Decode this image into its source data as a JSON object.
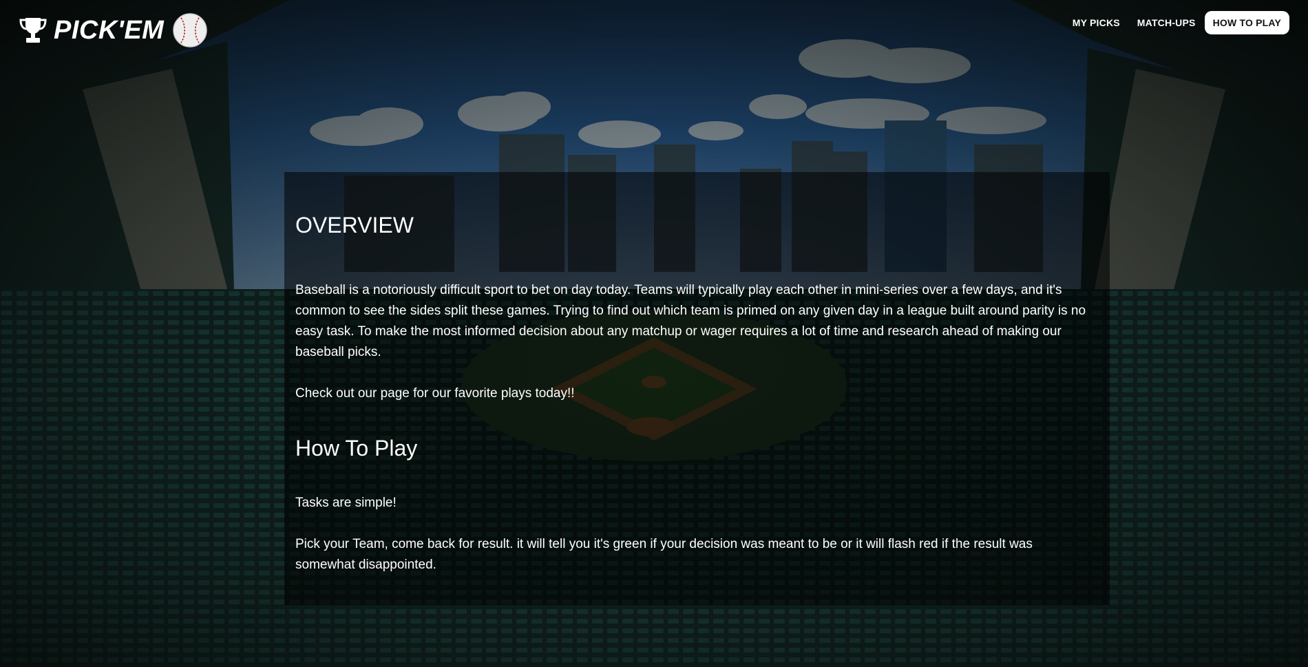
{
  "header": {
    "brand": "PICK'EM",
    "icons": {
      "left": "trophy-icon",
      "right": "baseball-icon"
    },
    "nav": [
      {
        "label": "MY PICKS",
        "active": false
      },
      {
        "label": "MATCH-UPS",
        "active": false
      },
      {
        "label": "HOW TO PLAY",
        "active": true
      }
    ]
  },
  "overview": {
    "title": "OVERVIEW",
    "paragraph1": "Baseball is a notoriously difficult sport to bet on day today. Teams will typically play each other in mini-series over a few days, and it's common to see the sides split these games. Trying to find out which team is primed on any given day in a league built around parity is no easy task. To make the most informed decision about any matchup or wager requires a lot of time and research ahead of making our baseball picks.",
    "paragraph2": "Check out our page for our favorite plays today!!"
  },
  "how_to_play": {
    "title": "How To Play",
    "paragraph1": "Tasks are simple!",
    "paragraph2": "Pick your Team, come back for result. it will tell you it's green if your decision was meant to be or it will flash red if the result was somewhat disappointed."
  },
  "colors": {
    "text": "#ffffff",
    "active_nav_bg": "#ffffff",
    "active_nav_text": "#111111",
    "panel_overlay": "rgba(0,0,0,0.55)",
    "sky": "#1f56a3",
    "field_grass": "#2f5a2a",
    "infield_dirt": "#8a5a2c"
  }
}
